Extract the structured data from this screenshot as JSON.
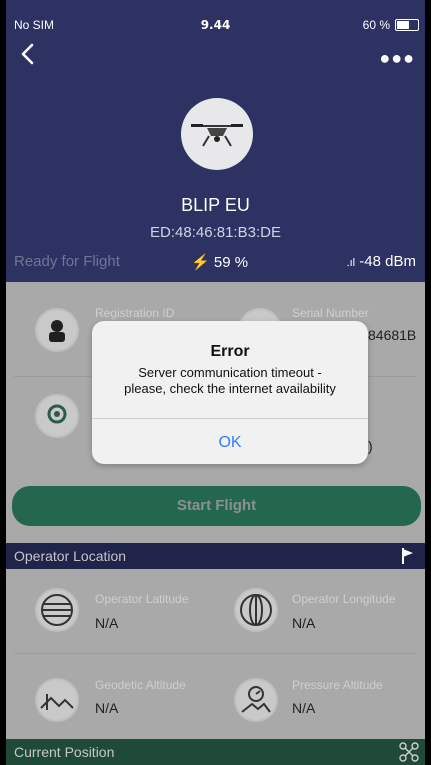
{
  "status_bar": {
    "carrier": "No SIM",
    "time": "9.44",
    "battery": "60 %"
  },
  "header": {
    "device_name": "BLIP EU",
    "mac": "ED:48:46:81:B3:DE",
    "state": "Ready for Flight",
    "battery": "59 %",
    "signal": "-48 dBm"
  },
  "info": {
    "registration_label": "Registration ID",
    "serial_label": "Serial Number",
    "serial_value_partial": "84681B",
    "second_value_partial": ")"
  },
  "actions": {
    "start_flight": "Start Flight"
  },
  "operator_location": {
    "title": "Operator Location",
    "latitude_label": "Operator Latitude",
    "latitude_value": "N/A",
    "longitude_label": "Operator Longitude",
    "longitude_value": "N/A",
    "geo_alt_label": "Geodetic Altitude",
    "geo_alt_value": "N/A",
    "press_alt_label": "Pressure Altitude",
    "press_alt_value": "N/A"
  },
  "current_position": {
    "title": "Current Position"
  },
  "modal": {
    "title": "Error",
    "message_line1": "Server communication timeout -",
    "message_line2": "please, check the internet availability",
    "ok": "OK"
  }
}
